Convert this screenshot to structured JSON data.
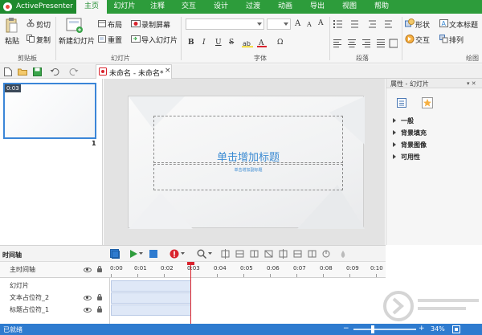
{
  "app": {
    "brand": "ActivePresenter"
  },
  "menu": {
    "tabs": [
      {
        "label": "主页",
        "active": true
      },
      {
        "label": "幻灯片"
      },
      {
        "label": "注释"
      },
      {
        "label": "交互"
      },
      {
        "label": "设计"
      },
      {
        "label": "过渡"
      },
      {
        "label": "动画"
      },
      {
        "label": "导出"
      },
      {
        "label": "视图"
      },
      {
        "label": "帮助"
      }
    ]
  },
  "ribbon": {
    "clipboard": {
      "paste": "粘贴",
      "cut": "剪切",
      "copy": "复制",
      "label": "剪贴板"
    },
    "slides": {
      "new_slide": "新建幻灯片",
      "layout": "布局",
      "record": "录制屏幕",
      "duplicate": "重置",
      "import": "导入幻灯片",
      "label": "幻灯片"
    },
    "font": {
      "label": "字体",
      "bold": "B",
      "italic": "I",
      "underline": "U",
      "strike": "S",
      "font_size_up": "A",
      "font_size_down": "A",
      "clear": "A",
      "omega": "Ω"
    },
    "paragraph": {
      "label": "段落"
    },
    "draw": {
      "shape": "形状",
      "text_title": "文本标题",
      "interact": "交互",
      "arrange": "排列",
      "label": "绘图"
    }
  },
  "document": {
    "tab_title": "未命名 - 未命名*",
    "close": "×"
  },
  "slide_panel": {
    "thumb_time": "0:03",
    "thumb_number": "1"
  },
  "slide": {
    "title_placeholder": "单击增加标题",
    "subtitle_placeholder": "单击增加副标题"
  },
  "properties": {
    "header": "属性 - 幻灯片",
    "pin": "▾ ✕",
    "sections": [
      "一般",
      "背景填充",
      "背景图像",
      "可用性"
    ]
  },
  "timeline": {
    "label": "时间轴",
    "main_row": "主时间轴",
    "rows": [
      "幻灯片",
      "文本占位符_2",
      "标题占位符_1"
    ],
    "ticks": [
      "0:00",
      "0:01",
      "0:02",
      "0:03",
      "0:04",
      "0:05",
      "0:06",
      "0:07",
      "0:08",
      "0:09",
      "0:10"
    ]
  },
  "status": {
    "text": "已就绪",
    "zoom": "34%"
  },
  "colors": {
    "brand_green": "#2d9c3b",
    "accent_blue": "#3a8ad2",
    "status_blue": "#2e7bcf",
    "playhead_red": "#d9232d"
  }
}
